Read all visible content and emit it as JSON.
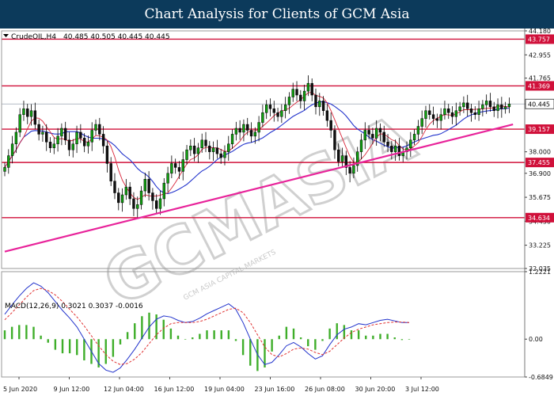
{
  "header": {
    "title": "Chart Analysis for Clients of GCM Asia"
  },
  "watermark": {
    "text": "GCMASIA",
    "subtext": "GCM ASIA CAPITAL MARKETS"
  },
  "colors": {
    "header_bg": "#0c3a5b",
    "resistance_support": "#d0103a",
    "trendline": "#e8239a",
    "ma_fast": "#d9263a",
    "ma_slow": "#2233cc",
    "candle_bull": "#10a010",
    "candle_bear": "#101010",
    "macd_line": "#2233cc",
    "signal_line": "#e03030",
    "histogram": "#3fae2a",
    "current_price_tag": "#ffffff"
  },
  "chart_data": [
    {
      "type": "candlestick",
      "instrument_label": "CrudeOIL,H4",
      "ohlc_label": "40.485 40.505 40.445 40.445",
      "ylim": [
        32.035,
        44.18
      ],
      "y_ticks": [
        "44.180",
        "42.955",
        "41.765",
        "40.445",
        "38.000",
        "36.900",
        "35.675",
        "34.450",
        "33.225",
        "32.035"
      ],
      "x_ticks": [
        "5 Jun 2020",
        "9 Jun 12:00",
        "12 Jun 04:00",
        "16 Jun 12:00",
        "19 Jun 04:00",
        "23 Jun 16:00",
        "26 Jun 08:00",
        "30 Jun 20:00",
        "3 Jul 12:00"
      ],
      "current_price": 40.445,
      "horizontal_levels": [
        {
          "label": "43.757",
          "value": 43.757
        },
        {
          "label": "41.369",
          "value": 41.369
        },
        {
          "label": "39.157",
          "value": 39.157
        },
        {
          "label": "37.455",
          "value": 37.455
        },
        {
          "label": "34.634",
          "value": 34.634
        }
      ],
      "trendline": {
        "from": [
          0,
          32.9
        ],
        "to": [
          134,
          39.4
        ]
      },
      "closes": [
        37.2,
        37.8,
        38.4,
        39.0,
        39.9,
        40.2,
        39.8,
        40.1,
        39.4,
        38.9,
        39.0,
        38.5,
        38.2,
        38.4,
        38.8,
        39.2,
        38.6,
        38.1,
        38.4,
        39.0,
        38.7,
        38.3,
        38.5,
        39.1,
        39.4,
        38.9,
        38.3,
        37.4,
        36.5,
        35.9,
        35.4,
        35.8,
        36.2,
        35.6,
        35.1,
        35.3,
        36.0,
        36.6,
        35.9,
        35.5,
        35.1,
        35.6,
        36.4,
        36.9,
        37.4,
        37.2,
        37.0,
        37.6,
        38.1,
        38.3,
        37.9,
        38.2,
        38.6,
        38.3,
        38.0,
        38.2,
        37.9,
        37.7,
        38.0,
        38.4,
        38.9,
        39.2,
        39.0,
        39.4,
        39.1,
        38.8,
        39.0,
        39.5,
        40.0,
        40.4,
        40.2,
        40.0,
        39.8,
        40.1,
        40.4,
        40.8,
        41.2,
        40.9,
        40.6,
        41.1,
        41.5,
        40.9,
        40.3,
        40.6,
        40.1,
        39.6,
        39.1,
        38.1,
        37.5,
        37.8,
        37.2,
        36.9,
        37.3,
        38.0,
        38.6,
        39.1,
        38.9,
        38.7,
        39.2,
        39.0,
        38.5,
        38.3,
        38.0,
        38.3,
        37.8,
        38.0,
        38.2,
        38.6,
        38.9,
        39.3,
        39.7,
        40.1,
        39.9,
        39.7,
        39.6,
        39.9,
        40.2,
        40.0,
        39.8,
        40.1,
        40.3,
        40.5,
        40.2,
        40.0,
        39.9,
        40.2,
        40.4,
        40.6,
        40.3,
        40.1,
        40.4,
        40.2,
        40.3,
        40.445
      ]
    },
    {
      "type": "line",
      "indicator_label": "MACD(12,26,9) 0.3021 0.3037 -0.0016",
      "ylim": [
        -0.6849,
        1.2221
      ],
      "y_ticks": [
        "1.2221",
        "0.00",
        "-0.6849"
      ],
      "series": [
        {
          "name": "MACD",
          "values": [
            0.45,
            0.62,
            0.78,
            0.92,
            1.02,
            0.96,
            0.84,
            0.68,
            0.52,
            0.38,
            0.22,
            0.0,
            -0.22,
            -0.44,
            -0.56,
            -0.6,
            -0.52,
            -0.36,
            -0.18,
            0.02,
            0.22,
            0.36,
            0.42,
            0.4,
            0.34,
            0.3,
            0.32,
            0.38,
            0.46,
            0.52,
            0.58,
            0.64,
            0.54,
            0.3,
            0.0,
            -0.28,
            -0.46,
            -0.42,
            -0.28,
            -0.12,
            -0.06,
            -0.14,
            -0.26,
            -0.36,
            -0.3,
            -0.1,
            0.08,
            0.18,
            0.22,
            0.28,
            0.26,
            0.3,
            0.34,
            0.36,
            0.33,
            0.3,
            0.3
          ]
        },
        {
          "name": "Signal",
          "values": [
            0.35,
            0.48,
            0.62,
            0.76,
            0.88,
            0.92,
            0.88,
            0.8,
            0.68,
            0.54,
            0.4,
            0.24,
            0.06,
            -0.12,
            -0.28,
            -0.4,
            -0.46,
            -0.44,
            -0.36,
            -0.24,
            -0.08,
            0.08,
            0.2,
            0.28,
            0.3,
            0.3,
            0.3,
            0.32,
            0.36,
            0.42,
            0.48,
            0.54,
            0.56,
            0.48,
            0.3,
            0.08,
            -0.14,
            -0.28,
            -0.32,
            -0.26,
            -0.18,
            -0.16,
            -0.18,
            -0.24,
            -0.28,
            -0.22,
            -0.1,
            0.02,
            0.12,
            0.18,
            0.22,
            0.26,
            0.28,
            0.3,
            0.31,
            0.31,
            0.3
          ]
        }
      ]
    }
  ]
}
